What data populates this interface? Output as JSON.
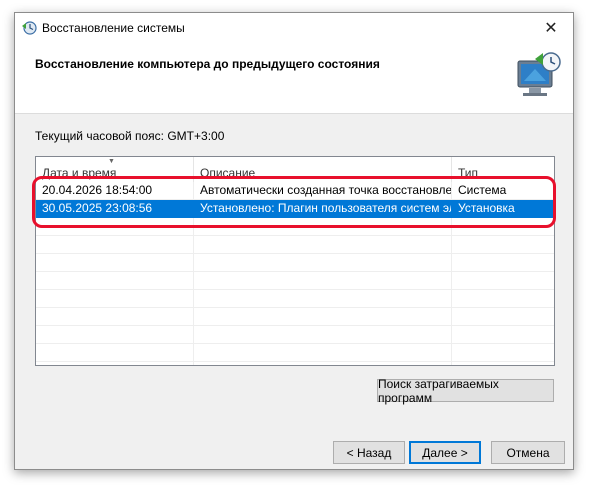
{
  "window": {
    "title": "Восстановление системы",
    "close_glyph": "✕"
  },
  "header": {
    "title": "Восстановление компьютера до предыдущего состояния"
  },
  "timezone_text": "Текущий часовой пояс: GMT+3:00",
  "list": {
    "columns": [
      "Дата и время",
      "Описание",
      "Тип"
    ],
    "sort_glyph": "▼",
    "rows": [
      {
        "date": "20.04.2026 18:54:00",
        "description": "Автоматически созданная точка восстановле...",
        "type": "Система"
      },
      {
        "date": "30.05.2025 23:08:56",
        "description": "Установлено: Плагин пользователя систем эл...",
        "type": "Установка"
      }
    ],
    "selected_index": 1
  },
  "buttons": {
    "scan": "Поиск затрагиваемых программ",
    "back": "< Назад",
    "next": "Далее >",
    "cancel": "Отмена"
  },
  "colors": {
    "selection": "#0078d7",
    "highlight": "#e8102c"
  }
}
